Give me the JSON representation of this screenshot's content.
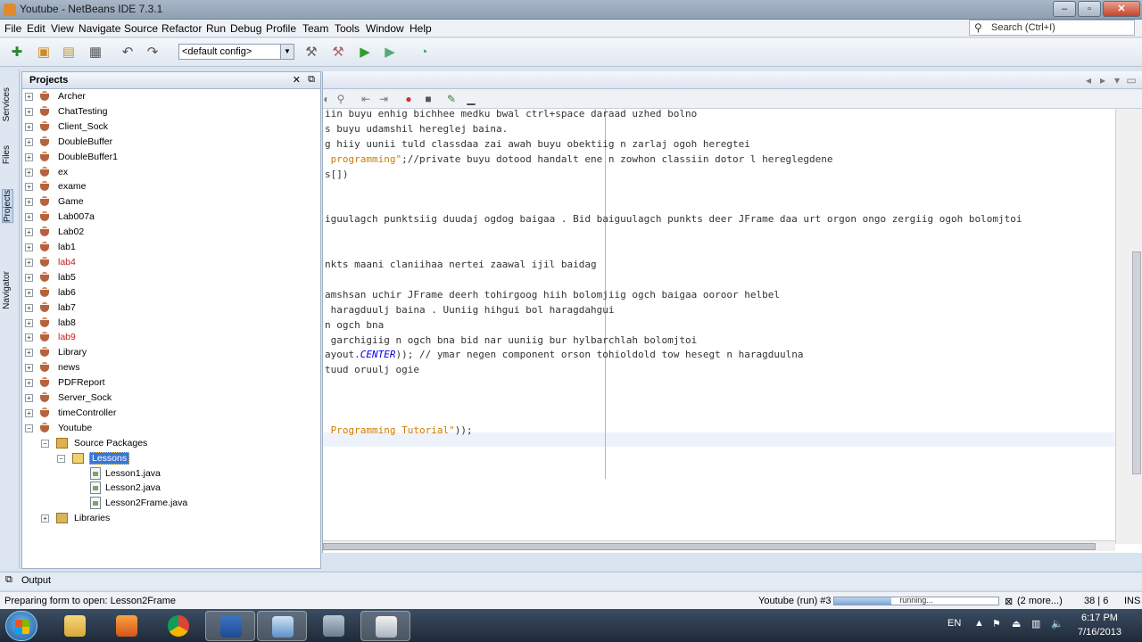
{
  "window": {
    "title": "Youtube - NetBeans IDE 7.3.1"
  },
  "menu": [
    "File",
    "Edit",
    "View",
    "Navigate",
    "Source",
    "Refactor",
    "Run",
    "Debug",
    "Profile",
    "Team",
    "Tools",
    "Window",
    "Help"
  ],
  "search": {
    "placeholder": "Search (Ctrl+I)"
  },
  "toolbar": {
    "config_value": "<default config>"
  },
  "side_tabs": [
    "Services",
    "Files",
    "Projects",
    "Navigator"
  ],
  "projects": {
    "title": "Projects",
    "items": [
      {
        "label": "Archer",
        "error": false
      },
      {
        "label": "ChatTesting",
        "error": false
      },
      {
        "label": "Client_Sock",
        "error": false
      },
      {
        "label": "DoubleBuffer",
        "error": false
      },
      {
        "label": "DoubleBuffer1",
        "error": false
      },
      {
        "label": "ex",
        "error": false
      },
      {
        "label": "exame",
        "error": false
      },
      {
        "label": "Game",
        "error": false
      },
      {
        "label": "Lab007a",
        "error": false
      },
      {
        "label": "Lab02",
        "error": false
      },
      {
        "label": "lab1",
        "error": false
      },
      {
        "label": "lab4",
        "error": true
      },
      {
        "label": "lab5",
        "error": false
      },
      {
        "label": "lab6",
        "error": false
      },
      {
        "label": "lab7",
        "error": false
      },
      {
        "label": "lab8",
        "error": false
      },
      {
        "label": "lab9",
        "error": true
      },
      {
        "label": "Library",
        "error": false
      },
      {
        "label": "news",
        "error": false
      },
      {
        "label": "PDFReport",
        "error": false
      },
      {
        "label": "Server_Sock",
        "error": false
      },
      {
        "label": "timeController",
        "error": false
      },
      {
        "label": "Youtube",
        "error": false
      }
    ],
    "youtube_children": {
      "source_packages": "Source Packages",
      "lessons": "Lessons",
      "files": [
        "Lesson1.java",
        "Lesson2.java",
        "Lesson2Frame.java"
      ],
      "libraries": "Libraries"
    }
  },
  "code_lines": [
    {
      "parts": [
        {
          "t": "iin buyu enhig bichhee medku bwal ctrl+space daraad uzhed bolno"
        }
      ]
    },
    {
      "parts": [
        {
          "t": "s buyu udamshil hereglej baina."
        }
      ]
    },
    {
      "parts": [
        {
          "t": "g hiiy uunii tuld classdaa zai awah buyu obektiig n zarlaj ogoh heregtei"
        }
      ]
    },
    {
      "parts": [
        {
          "t": " programming\"",
          "c": "str"
        },
        {
          "t": ";//private buyu dotood handalt ene n zowhon classiin dotor l hereglegdene"
        }
      ]
    },
    {
      "parts": [
        {
          "t": "s[])"
        }
      ]
    },
    {
      "parts": [
        {
          "t": ""
        }
      ]
    },
    {
      "parts": [
        {
          "t": ""
        }
      ]
    },
    {
      "parts": [
        {
          "t": "iguulagch punktsiig duudaj ogdog baigaa . Bid baiguulagch punkts deer JFrame daa urt orgon ongo zergiig ogoh bolomjtoi"
        }
      ]
    },
    {
      "parts": [
        {
          "t": ""
        }
      ]
    },
    {
      "parts": [
        {
          "t": ""
        }
      ]
    },
    {
      "parts": [
        {
          "t": "nkts maani claniihaa nertei zaawal ijil baidag"
        }
      ]
    },
    {
      "parts": [
        {
          "t": ""
        }
      ]
    },
    {
      "parts": [
        {
          "t": "amshsan uchir JFrame deerh tohirgoog hiih bolomjiig ogch baigaa ooroor helbel"
        }
      ]
    },
    {
      "parts": [
        {
          "t": " haragduulj baina . Uuniig hihgui bol haragdahgui"
        }
      ]
    },
    {
      "parts": [
        {
          "t": "n ogch bna"
        }
      ]
    },
    {
      "parts": [
        {
          "t": " garchigiig n ogch bna bid nar uuniig bur hylbarchlah bolomjtoi"
        }
      ]
    },
    {
      "parts": [
        {
          "t": "ayout."
        },
        {
          "t": "CENTER",
          "c": "const"
        },
        {
          "t": ")); // ymar negen component orson tohioldold tow hesegt n haragduulna"
        }
      ]
    },
    {
      "parts": [
        {
          "t": "tuud oruulj ogie"
        }
      ]
    },
    {
      "parts": [
        {
          "t": ""
        }
      ]
    },
    {
      "parts": [
        {
          "t": ""
        }
      ]
    },
    {
      "parts": [
        {
          "t": ""
        }
      ]
    },
    {
      "parts": [
        {
          "t": " Programming Tutorial\"",
          "c": "str"
        },
        {
          "t": "));"
        }
      ]
    }
  ],
  "output": {
    "label": "Output"
  },
  "status": {
    "message": "Preparing form to open: Lesson2Frame",
    "run_label": "Youtube (run) #3",
    "progress_text": "running...",
    "progress_fraction": 0.35,
    "more": "(2 more...)",
    "position": "38 | 6",
    "mode": "INS"
  },
  "taskbar": {
    "lang": "EN",
    "time": "6:17 PM",
    "date": "7/16/2013"
  }
}
